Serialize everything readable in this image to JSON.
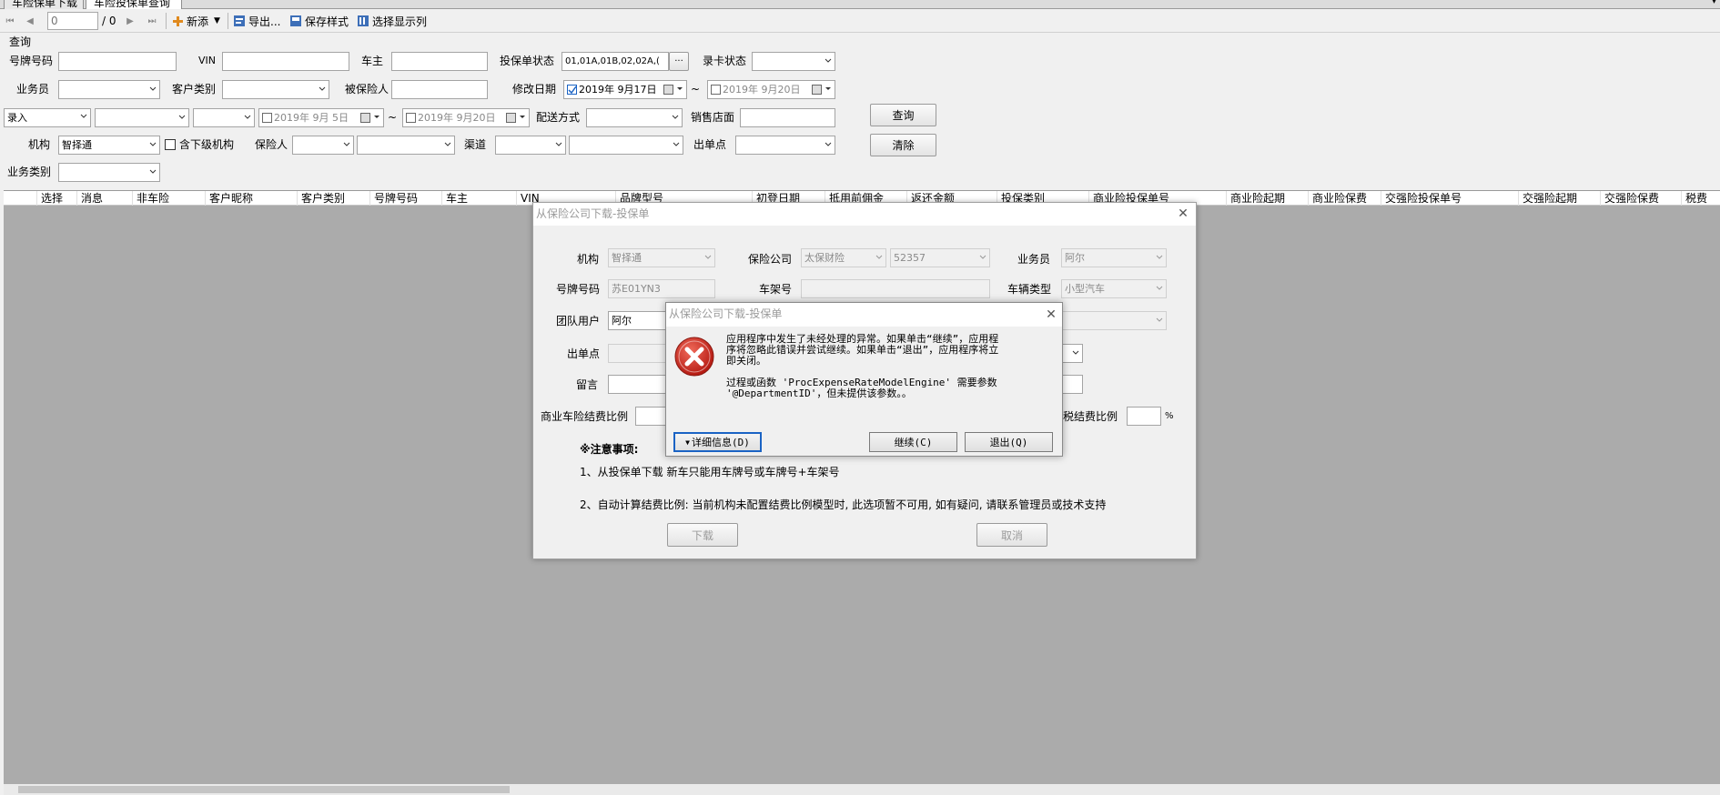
{
  "tabs": [
    {
      "label": "车险保单下载"
    },
    {
      "label": "车险投保单查询"
    }
  ],
  "toolbar": {
    "page_input": "0",
    "page_total": "/ 0",
    "add_label": "新添",
    "export_label": "导出...",
    "save_style_label": "保存样式",
    "select_columns_label": "选择显示列"
  },
  "form": {
    "group_title": "查询",
    "plate_label": "号牌号码",
    "vin_label": "VIN",
    "owner_label": "车主",
    "status_label": "投保单状态",
    "status_value": "01,01A,01B,02,02A,(",
    "card_status_label": "录卡状态",
    "salesman_label": "业务员",
    "customer_type_label": "客户类别",
    "insured_label": "被保险人",
    "modify_date_label": "修改日期",
    "modify_date_from": "2019年 9月17日",
    "modify_date_to": "2019年 9月20日",
    "entry_select": "录入",
    "entry_date_from": "2019年 9月 5日",
    "entry_date_to": "2019年 9月20日",
    "delivery_label": "配送方式",
    "store_label": "销售店面",
    "org_label": "机构",
    "org_value": "智择通",
    "sub_org_label": "含下级机构",
    "insurer_label": "保险人",
    "channel_label": "渠道",
    "outlet_label": "出单点",
    "biz_type_label": "业务类别",
    "query_button": "查询",
    "clear_button": "清除",
    "tilde": "~"
  },
  "grid": {
    "columns": [
      "选择",
      "消息",
      "非车险",
      "客户昵称",
      "客户类别",
      "号牌号码",
      "车主",
      "VIN",
      "品牌型号",
      "初登日期",
      "抵用前佣金",
      "返还金额",
      "投保类别",
      "商业险投保单号",
      "商业险起期",
      "商业险保费",
      "交强险投保单号",
      "交强险起期",
      "交强险保费",
      "税费"
    ]
  },
  "download_dialog": {
    "title": "从保险公司下载-投保单",
    "org_label": "机构",
    "org_value": "智择通",
    "insurer_label": "保险公司",
    "insurer_value": "太保财险",
    "insurer_code": "52357",
    "salesman_label": "业务员",
    "salesman_value": "阿尔",
    "plate_label": "号牌号码",
    "plate_value": "苏E01YN3",
    "frame_label": "车架号",
    "vehicle_type_label": "车辆类型",
    "vehicle_type_value": "小型汽车",
    "team_user_label": "团队用户",
    "team_user_value": "阿尔",
    "outlet_label": "出单点",
    "remark_label": "留言",
    "commercial_ratio_label": "商业车险结费比例",
    "tax_ratio_label": "税结费比例",
    "percent": "%",
    "notes_title": "※注意事项:",
    "note1": "1、从投保单下载 新车只能用车牌号或车牌号+车架号",
    "note2": "2、自动计算结费比例: 当前机构未配置结费比例模型时, 此选项暂不可用, 如有疑问, 请联系管理员或技术支持",
    "download_button": "下载",
    "cancel_button": "取消"
  },
  "error_dialog": {
    "title": "从保险公司下载-投保单",
    "message_line1": "应用程序中发生了未经处理的异常。如果单击“继续”，应用程",
    "message_line2": "序将忽略此错误并尝试继续。如果单击“退出”，应用程序将立",
    "message_line3": "即关闭。",
    "detail_line1": "过程或函数 'ProcExpenseRateModelEngine' 需要参数",
    "detail_line2": "'@DepartmentID'，但未提供该参数。。",
    "details_button": "详细信息(D)",
    "continue_button": "继续(C)",
    "quit_button": "退出(Q)"
  },
  "colors": {
    "grid_background": "#ababab",
    "error_icon": "#c8201a"
  }
}
